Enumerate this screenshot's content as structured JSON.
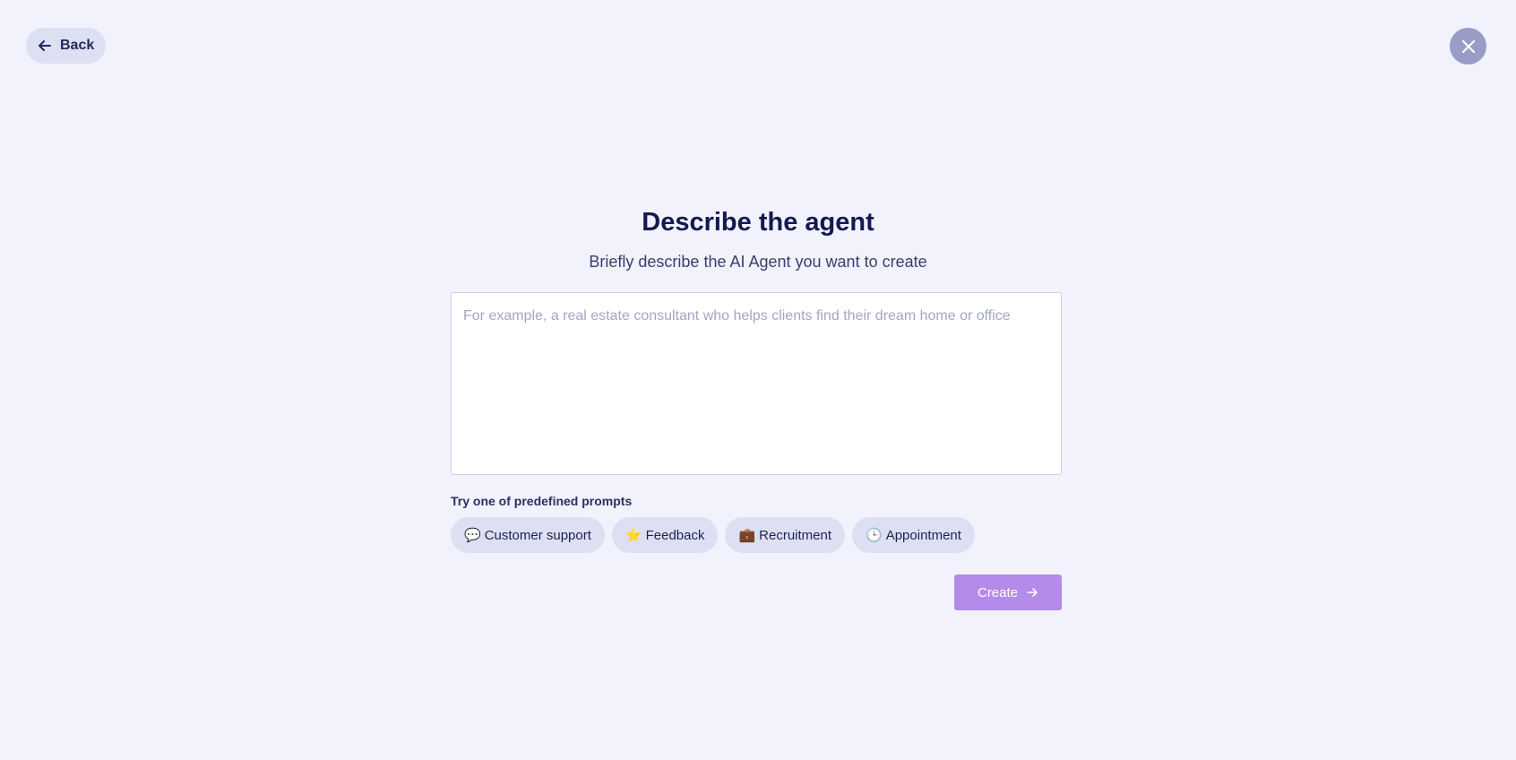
{
  "header": {
    "back_label": "Back",
    "back_icon": "arrow-left-icon",
    "close_icon": "close-icon"
  },
  "main": {
    "title": "Describe the agent",
    "subtitle": "Briefly describe the AI Agent you want to create",
    "description_placeholder": "For example, a real estate consultant who helps clients find their dream home or office",
    "description_value": ""
  },
  "prompts": {
    "label": "Try one of predefined prompts",
    "items": [
      {
        "emoji": "💬",
        "label": "Customer support"
      },
      {
        "emoji": "⭐",
        "label": "Feedback"
      },
      {
        "emoji": "💼",
        "label": "Recruitment"
      },
      {
        "emoji": "🕒",
        "label": "Appointment"
      }
    ]
  },
  "actions": {
    "create_label": "Create",
    "create_icon": "arrow-right-icon"
  },
  "colors": {
    "background": "#f1f2fc",
    "chip_background": "#dde0f3",
    "close_button": "#979dc6",
    "create_button": "#b48aea",
    "title_text": "#141a4f"
  }
}
